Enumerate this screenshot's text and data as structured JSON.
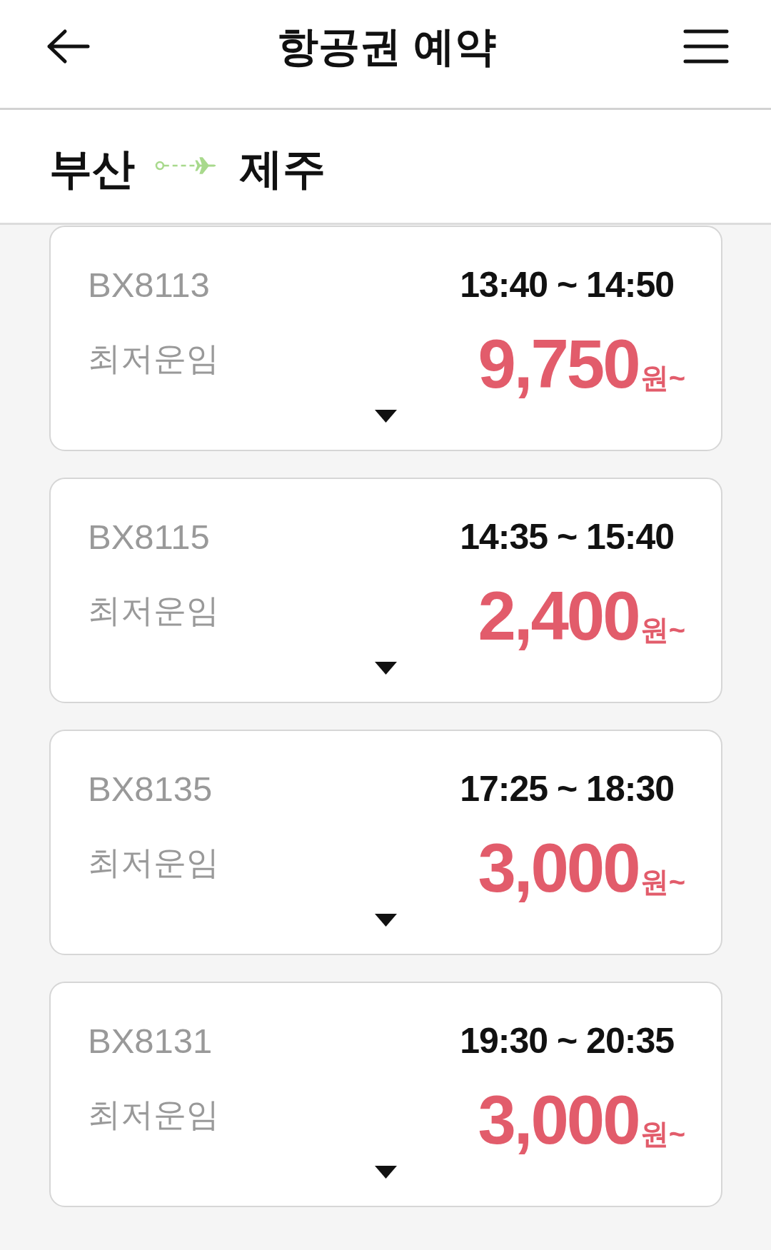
{
  "header": {
    "title": "항공권 예약"
  },
  "route": {
    "origin": "부산",
    "destination": "제주"
  },
  "flights": [
    {
      "flight_number": "BX8113",
      "time": "13:40 ~ 14:50",
      "fare_label": "최저운임",
      "price": "9,750",
      "unit": "원~"
    },
    {
      "flight_number": "BX8115",
      "time": "14:35 ~ 15:40",
      "fare_label": "최저운임",
      "price": "2,400",
      "unit": "원~"
    },
    {
      "flight_number": "BX8135",
      "time": "17:25 ~ 18:30",
      "fare_label": "최저운임",
      "price": "3,000",
      "unit": "원~"
    },
    {
      "flight_number": "BX8131",
      "time": "19:30 ~ 20:35",
      "fare_label": "최저운임",
      "price": "3,000",
      "unit": "원~"
    }
  ]
}
